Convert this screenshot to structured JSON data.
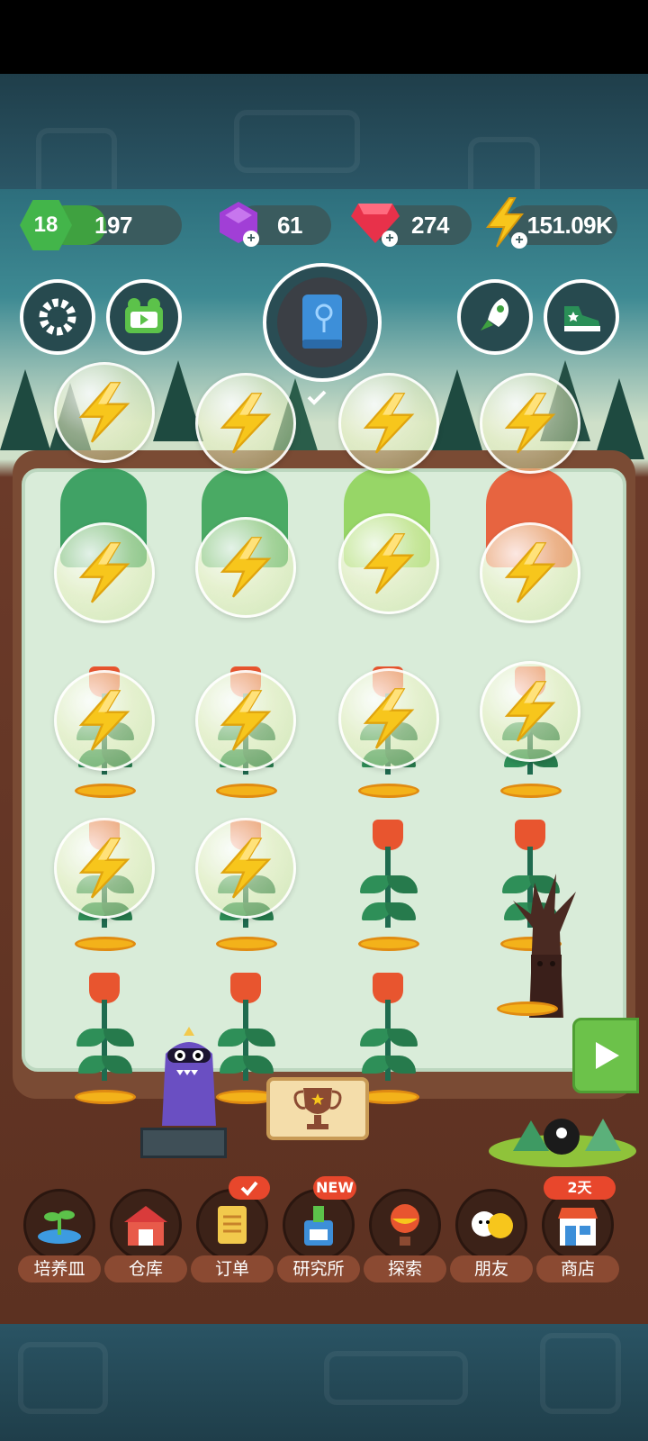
{
  "hud": {
    "level": "18",
    "xp": "197",
    "xp_progress": 0.45,
    "purple_gems": "61",
    "red_gems": "274",
    "energy": "151.09K"
  },
  "icons": {
    "settings": "gear-icon",
    "video": "video-icon",
    "book": "book-icon",
    "rocket": "rocket-icon",
    "shoe": "sneaker-icon",
    "bolt": "lightning-icon",
    "play": "play-icon"
  },
  "nav": [
    {
      "id": "dish",
      "label": "培养皿",
      "icon": "seedling-icon"
    },
    {
      "id": "warehouse",
      "label": "仓库",
      "icon": "barn-icon"
    },
    {
      "id": "orders",
      "label": "订单",
      "icon": "scroll-icon"
    },
    {
      "id": "lab",
      "label": "研究所",
      "icon": "flask-icon"
    },
    {
      "id": "explore",
      "label": "探索",
      "icon": "balloon-icon"
    },
    {
      "id": "friends",
      "label": "朋友",
      "icon": "friends-icon"
    },
    {
      "id": "shop",
      "label": "商店",
      "icon": "shop-icon"
    }
  ],
  "badges": {
    "new": "NEW",
    "shop_timer": "2天"
  },
  "colors": {
    "accent_green": "#43b54a",
    "bolt_yellow": "#f7c61c",
    "badge_red": "#e8472c"
  }
}
